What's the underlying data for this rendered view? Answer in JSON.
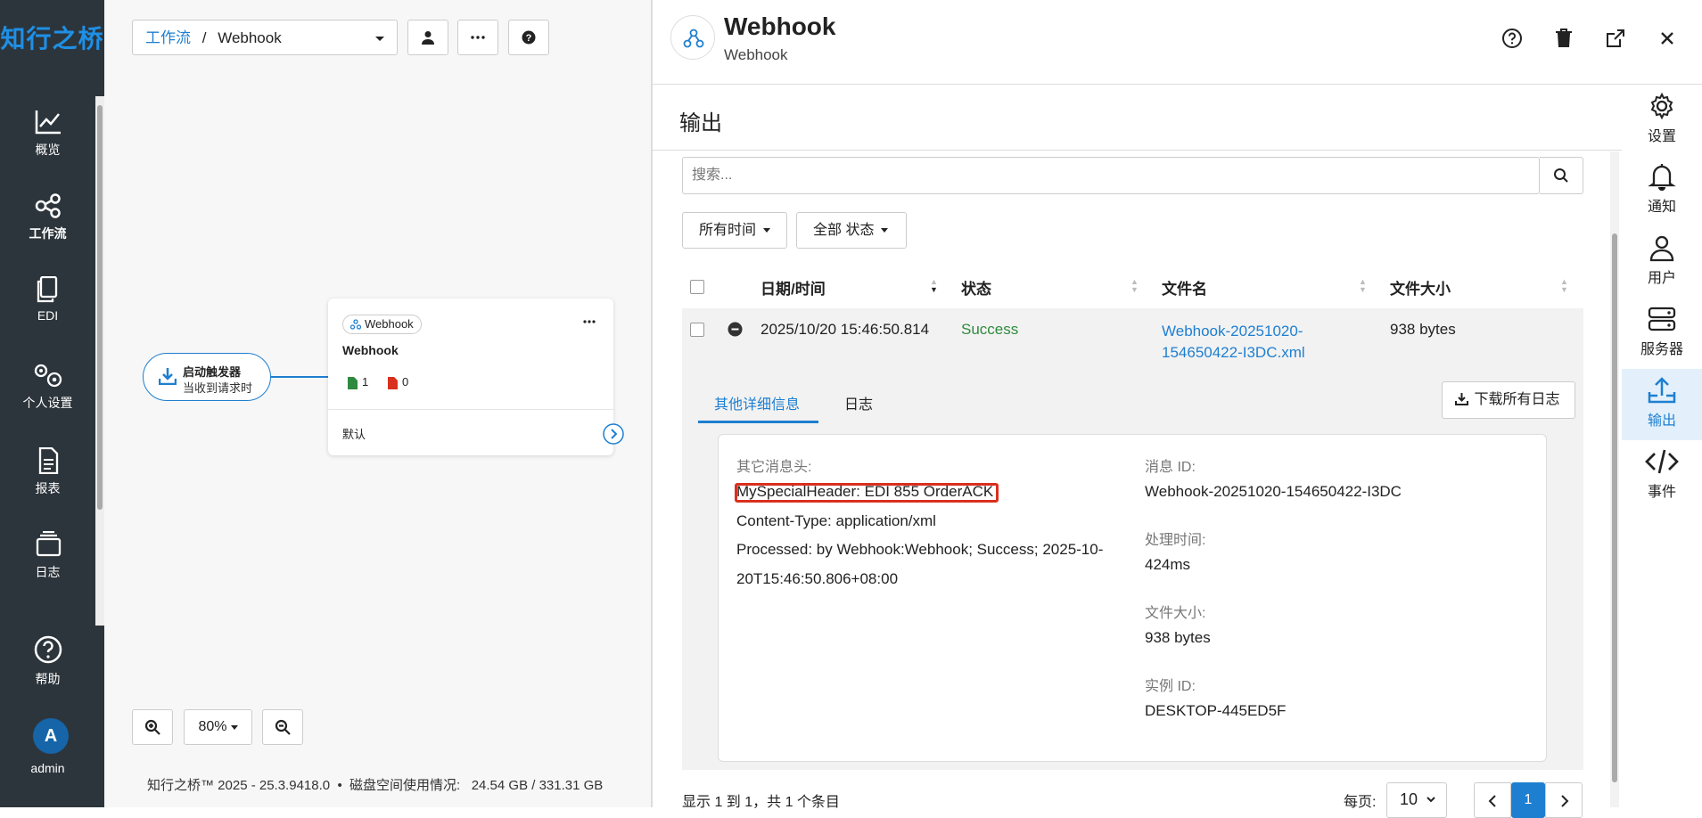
{
  "app": {
    "logo": "知行之桥",
    "user": {
      "initial": "A",
      "name": "admin"
    }
  },
  "nav": {
    "items": [
      {
        "label": "概览"
      },
      {
        "label": "工作流"
      },
      {
        "label": "EDI"
      },
      {
        "label": "个人设置"
      },
      {
        "label": "报表"
      },
      {
        "label": "日志"
      }
    ],
    "help": "帮助"
  },
  "canvas": {
    "breadcrumb": {
      "root": "工作流",
      "sep": "/",
      "current": "Webhook"
    },
    "trigger": {
      "title": "启动触发器",
      "subtitle": "当收到请求时"
    },
    "node": {
      "badge": "Webhook",
      "title": "Webhook",
      "success_count": "1",
      "error_count": "0",
      "output_label": "默认"
    },
    "zoom": "80%",
    "footer": "知行之桥™ 2025 - 25.3.9418.0  •  磁盘空间使用情况:   24.54 GB / 331.31 GB"
  },
  "panel": {
    "title": "Webhook",
    "subtitle": "Webhook",
    "section": "输出",
    "search_placeholder": "搜索...",
    "filters": {
      "time": "所有时间",
      "status": "全部 状态"
    },
    "columns": [
      "日期/时间",
      "状态",
      "文件名",
      "文件大小"
    ],
    "rows": [
      {
        "datetime": "2025/10/20 15:46:50.814",
        "status": "Success",
        "filename_1": "Webhook-20251020-",
        "filename_2": "154650422-I3DC.xml",
        "size": "938 bytes"
      }
    ],
    "tabs": [
      "其他详细信息",
      "日志"
    ],
    "download_all": "下载所有日志",
    "details": {
      "headers_label": "其它消息头:",
      "headers": [
        "MySpecialHeader: EDI 855 OrderACK",
        "Content-Type: application/xml",
        "Processed: by Webhook:Webhook; Success; 2025-10-",
        "20T15:46:50.806+08:00"
      ],
      "msgid_label": "消息 ID:",
      "msgid": "Webhook-20251020-154650422-I3DC",
      "time_label": "处理时间:",
      "time": "424ms",
      "size_label": "文件大小:",
      "size": "938 bytes",
      "instance_label": "实例 ID:",
      "instance": "DESKTOP-445ED5F"
    },
    "footer": {
      "summary": "显示 1 到 1，共 1 个条目",
      "per_page_label": "每页:",
      "per_page": "10",
      "page": "1"
    }
  },
  "sidebar": {
    "items": [
      {
        "label": "设置"
      },
      {
        "label": "通知"
      },
      {
        "label": "用户"
      },
      {
        "label": "服务器"
      },
      {
        "label": "输出"
      },
      {
        "label": "事件"
      }
    ]
  },
  "colors": {
    "accent": "#1e7fd0",
    "nav_bg": "#2d353c",
    "success": "#2e8b3e",
    "highlight": "#d9301e"
  }
}
